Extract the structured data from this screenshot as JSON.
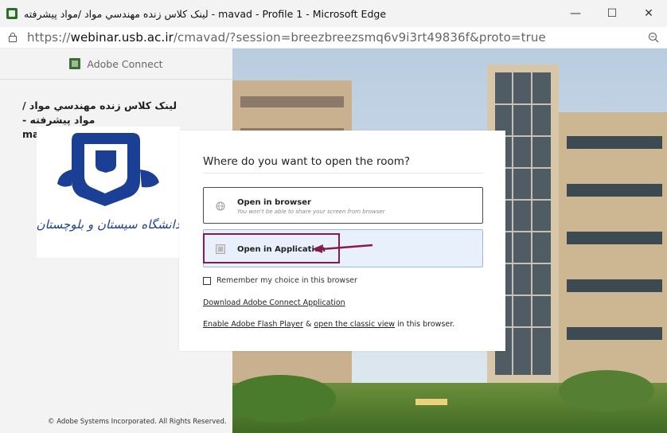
{
  "window": {
    "title": "لینک کلاس زنده مهندسي مواد /مواد پيشرفته - mavad - Profile 1 - Microsoft Edge",
    "minimize": "—",
    "maximize": "☐",
    "close": "✕"
  },
  "address": {
    "url_prefix": "https://",
    "url_host": "webinar.usb.ac.ir",
    "url_path": "/cmavad/?session=breezbreezsmq6v9i3rt49836f&proto=true"
  },
  "sidebar": {
    "app_name": "Adobe Connect",
    "room_title_line1": "لینک کلاس زنده مهندسي مواد /مواد پيشرفته -",
    "room_title_line2": "mavad",
    "university_name": "دانشگاه سیستان و بلوچستان",
    "copyright": "© Adobe Systems Incorporated. All Rights Reserved."
  },
  "dialog": {
    "title": "Where do you want to open the room?",
    "option_browser_label": "Open in browser",
    "option_browser_sub": "You won't be able to share your screen from browser",
    "option_app_label": "Open in Application",
    "remember_label": "Remember my choice in this browser",
    "download_link": "Download Adobe Connect Application",
    "flash_link": "Enable Adobe Flash Player",
    "amp": " & ",
    "classic_link": "open the classic view",
    "suffix": " in this browser."
  },
  "colors": {
    "annotation": "#8a1a4a",
    "app_option_bg": "#e8f0fc",
    "app_option_border": "#9ab9e6",
    "logo_blue": "#1b3f94"
  },
  "icons": {
    "globe": "globe-icon",
    "app": "application-icon",
    "lock": "lock-icon",
    "zoom": "zoom-out-icon"
  }
}
